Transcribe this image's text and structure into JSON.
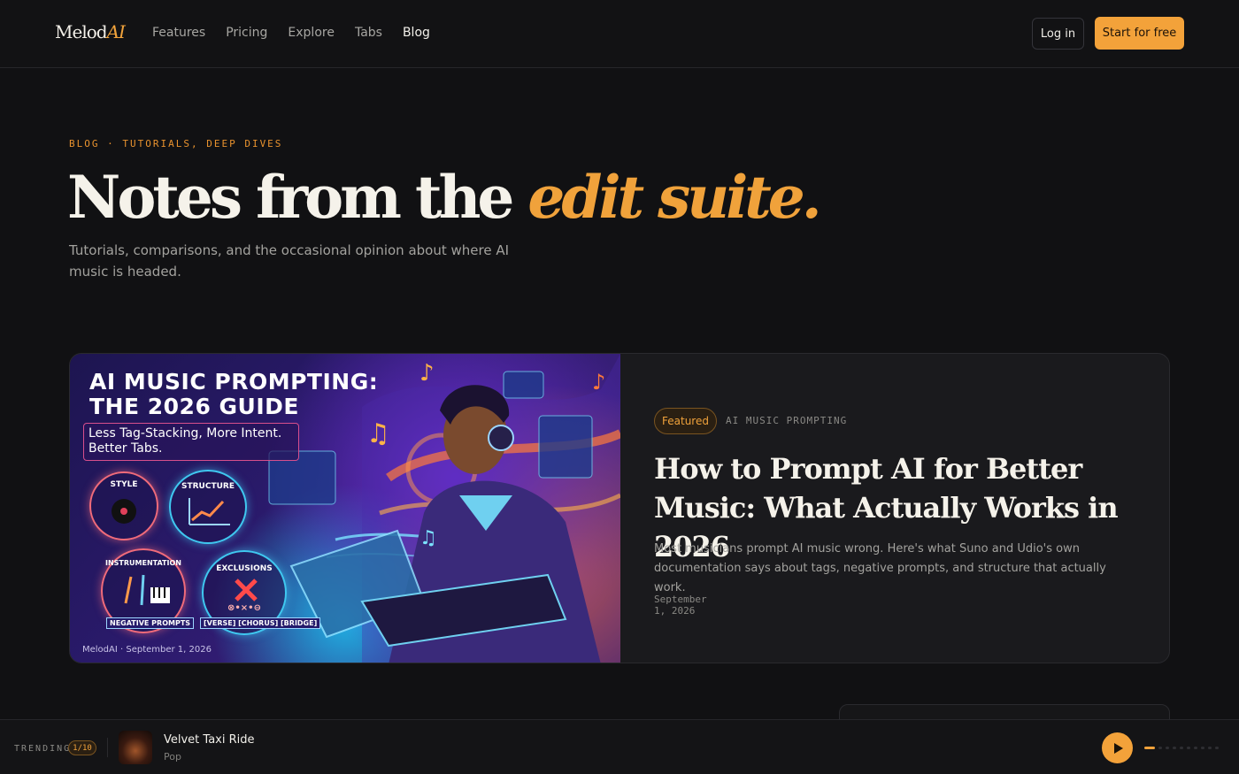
{
  "nav": {
    "logo_text": "Melod",
    "logo_accent": "AI",
    "links": [
      "Features",
      "Pricing",
      "Explore",
      "Tabs",
      "Blog"
    ],
    "active_link": "Blog",
    "login_label": "Log in",
    "start_label": "Start for free"
  },
  "hero": {
    "eyebrow": "BLOG · TUTORIALS, DEEP DIVES",
    "headline_plain": "Notes from the ",
    "headline_accent": "edit suite.",
    "subhead": "Tutorials, comparisons, and the occasional opinion about where AI music is headed."
  },
  "featured": {
    "image": {
      "title_line1": "AI MUSIC PROMPTING:",
      "title_line2": "THE 2026 GUIDE",
      "tagline": "Less Tag-Stacking, More Intent. Better Tabs.",
      "circles": {
        "style": "STYLE",
        "structure": "STRUCTURE",
        "instrumentation": "INSTRUMENTATION",
        "exclusions": "EXCLUSIONS"
      },
      "tag_negative": "NEGATIVE PROMPTS",
      "tag_sections": "[VERSE] [CHORUS] [BRIDGE]",
      "exclusion_symbols": "⊗•×•⊖",
      "credit": "MelodAI · September 1, 2026"
    },
    "badge": "Featured",
    "category": "AI MUSIC PROMPTING",
    "title": "How to Prompt AI for Better Music: What Actually Works in 2026",
    "description": "Most musicians prompt AI music wrong. Here's what Suno and Udio's own documentation says about tags, negative prompts, and structure that actually work.",
    "date": "September 1, 2026"
  },
  "player": {
    "trending_label": "TRENDING",
    "track_count": "1/10",
    "track_title": "Velvet Taxi Ride",
    "track_genre": "Pop",
    "progress_index": 1,
    "progress_total": 10
  },
  "colors": {
    "accent": "#f3a23a",
    "background": "#111113",
    "card": "#1a1a1d"
  }
}
